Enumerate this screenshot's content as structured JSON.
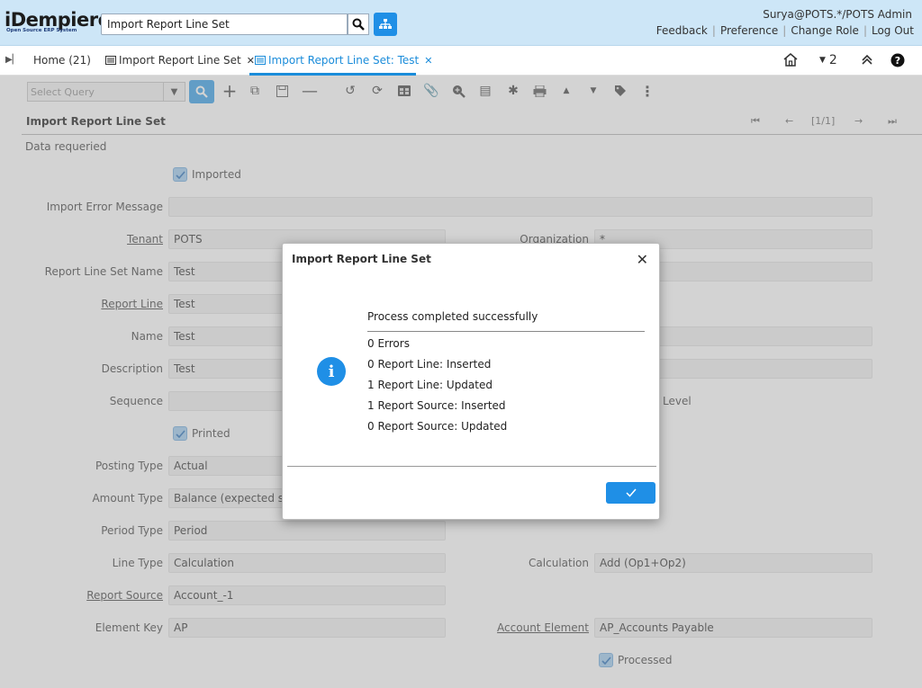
{
  "header": {
    "logo_text": "iDempiere",
    "logo_sub": "Open Source ERP System",
    "search_value": "Import Report Line Set",
    "user": "Surya@POTS.*/POTS Admin",
    "links": [
      "Feedback",
      "Preference",
      "Change Role",
      "Log Out"
    ]
  },
  "tabs": {
    "home": "Home (21)",
    "tab1": "Import Report Line Set",
    "tab2": "Import Report Line Set: Test",
    "window_count": "2"
  },
  "toolbar": {
    "query_placeholder": "Select Query"
  },
  "window": {
    "title": "Import Report Line Set",
    "record_nav": "[1/1]",
    "status": "Data requeried"
  },
  "form": {
    "imported_label": "Imported",
    "import_error_label": "Import Error Message",
    "import_error_value": "",
    "tenant_label": "Tenant",
    "tenant_value": "POTS",
    "organization_label": "Organization",
    "organization_value": "*",
    "report_line_set_name_label": "Report Line Set Name",
    "report_line_set_name_value": "Test",
    "report_line_label": "Report Line",
    "report_line_value": "Test",
    "name_label": "Name",
    "name_value": "Test",
    "description_label": "Description",
    "description_value": "Test",
    "sequence_label": "Sequence",
    "sequence_value": "",
    "level_label_fragment": "Level",
    "printed_label": "Printed",
    "posting_type_label": "Posting Type",
    "posting_type_value": "Actual",
    "amount_type_label": "Amount Type",
    "amount_type_value": "Balance (expected sign)",
    "period_type_label": "Period Type",
    "period_type_value": "Period",
    "line_type_label": "Line Type",
    "line_type_value": "Calculation",
    "calculation_label": "Calculation",
    "calculation_value": "Add (Op1+Op2)",
    "report_source_label": "Report Source",
    "report_source_value": "Account_-1",
    "element_key_label": "Element Key",
    "element_key_value": "AP",
    "account_element_label": "Account Element",
    "account_element_value": "AP_Accounts Payable",
    "processed_label": "Processed"
  },
  "dialog": {
    "title": "Import Report Line Set",
    "headline": "Process completed successfully",
    "lines": [
      "0 Errors",
      "0 Report Line: Inserted",
      "1 Report Line: Updated",
      "1 Report Source: Inserted",
      "0 Report Source: Updated"
    ]
  },
  "colors": {
    "header_bg": "#cde6f7",
    "accent": "#1f8fe6",
    "active_tab": "#1a8cda"
  }
}
